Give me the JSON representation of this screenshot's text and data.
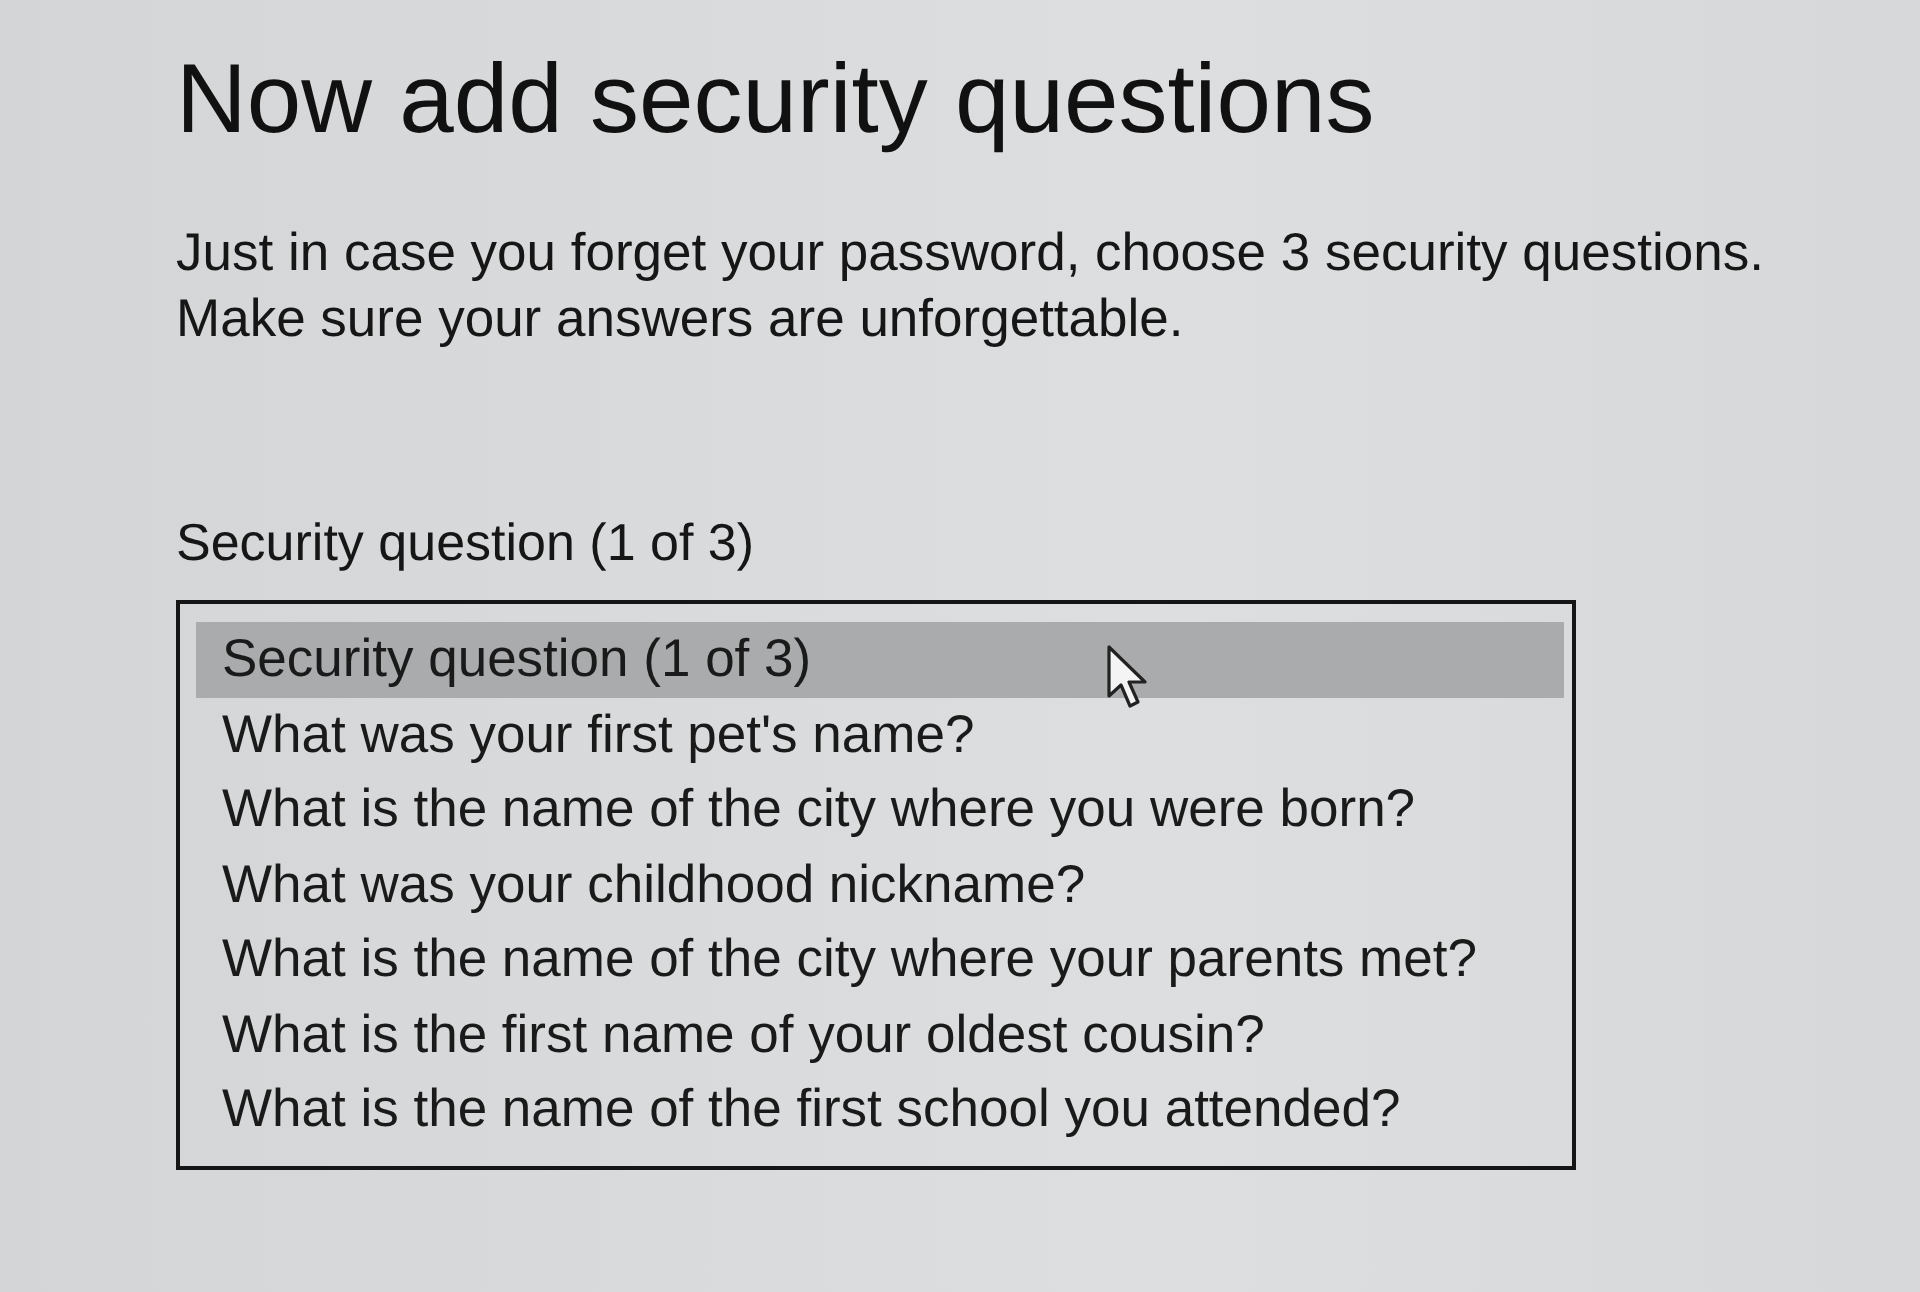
{
  "title": "Now add security questions",
  "intro": [
    "Just in case you forget your password, choose 3 security questions.",
    "Make sure your answers are unforgettable."
  ],
  "question_select": {
    "label": "Security question (1 of 3)",
    "options": [
      {
        "label": "Security question (1 of 3)",
        "selected": true
      },
      {
        "label": "What was your first pet's name?",
        "selected": false
      },
      {
        "label": "What is the name of the city where you were born?",
        "selected": false
      },
      {
        "label": "What was your childhood nickname?",
        "selected": false
      },
      {
        "label": "What is the name of the city where your parents met?",
        "selected": false
      },
      {
        "label": "What is the first name of your oldest cousin?",
        "selected": false
      },
      {
        "label": "What is the name of the first school you attended?",
        "selected": false
      }
    ]
  }
}
